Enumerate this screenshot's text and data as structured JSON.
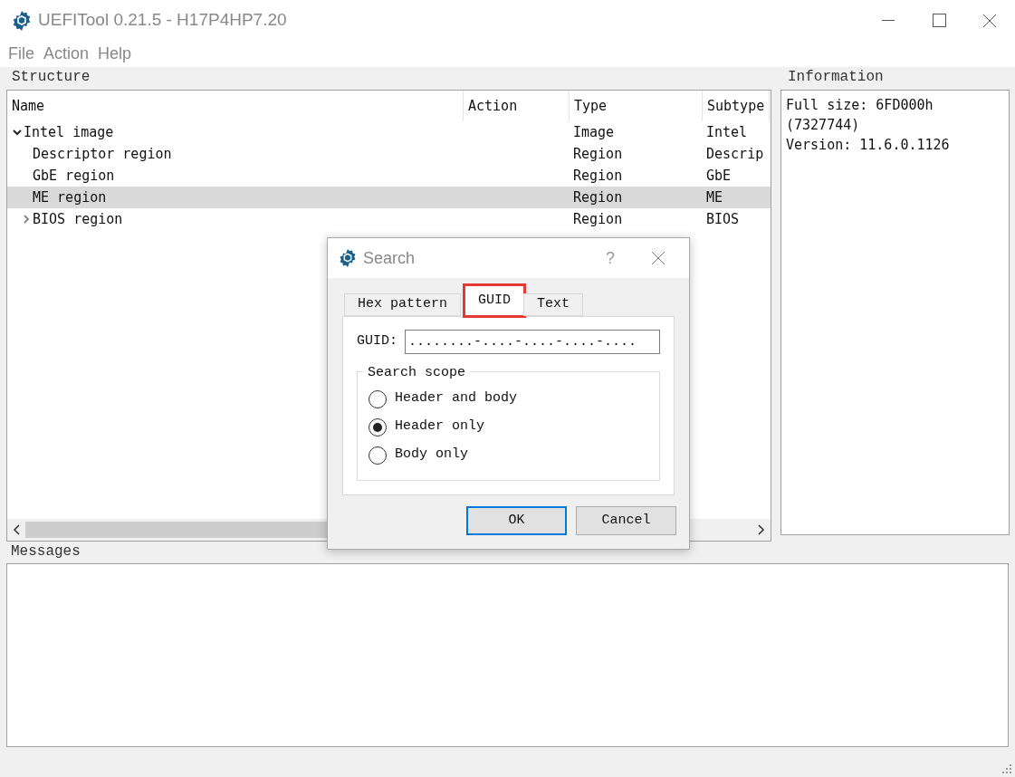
{
  "window": {
    "title": "UEFITool 0.21.5 - H17P4HP7.20"
  },
  "menu": [
    "File",
    "Action",
    "Help"
  ],
  "structure": {
    "title": "Structure",
    "columns": [
      "Name",
      "Action",
      "Type",
      "Subtype"
    ],
    "rows": [
      {
        "name": "Intel image",
        "type": "Image",
        "subtype": "Intel",
        "expanded": true,
        "selected": false,
        "children": [
          {
            "name": "Descriptor region",
            "type": "Region",
            "subtype": "Descrip",
            "selected": false
          },
          {
            "name": "GbE region",
            "type": "Region",
            "subtype": "GbE",
            "selected": false
          },
          {
            "name": "ME region",
            "type": "Region",
            "subtype": "ME",
            "selected": true
          },
          {
            "name": "BIOS region",
            "type": "Region",
            "subtype": "BIOS",
            "expanded": false,
            "selected": false,
            "has_children": true
          }
        ]
      }
    ]
  },
  "information": {
    "title": "Information",
    "lines": [
      "Full size: 6FD000h",
      "(7327744)",
      "Version: 11.6.0.1126"
    ]
  },
  "messages": {
    "title": "Messages"
  },
  "dialog": {
    "title": "Search",
    "help": "?",
    "tabs": [
      {
        "label": "Hex pattern",
        "selected": false,
        "highlighted": false
      },
      {
        "label": "GUID",
        "selected": true,
        "highlighted": true
      },
      {
        "label": "Text",
        "selected": false,
        "highlighted": false
      }
    ],
    "guid_label": "GUID:",
    "guid_value": "........-....-....-....-....",
    "scope": {
      "title": "Search scope",
      "options": [
        {
          "label": "Header and body",
          "selected": false
        },
        {
          "label": "Header only",
          "selected": true
        },
        {
          "label": "Body only",
          "selected": false
        }
      ]
    },
    "buttons": [
      {
        "label": "OK",
        "focused": true
      },
      {
        "label": "Cancel",
        "focused": false
      }
    ]
  }
}
